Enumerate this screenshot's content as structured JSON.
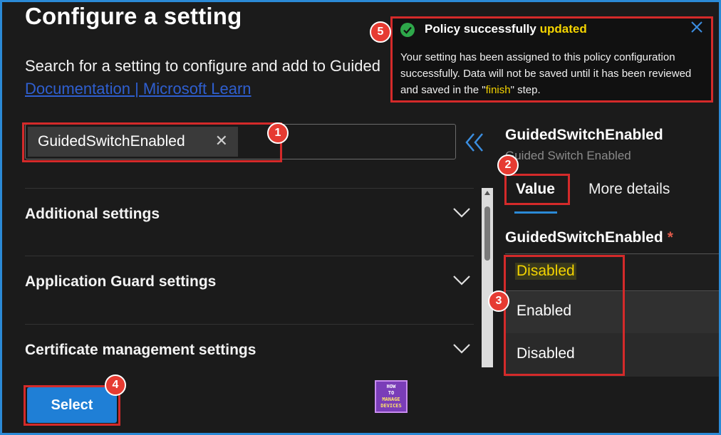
{
  "page": {
    "title": "Configure a setting",
    "description": "Search for a setting to configure and add to Guided",
    "doc_link": "Documentation | Microsoft Learn"
  },
  "search": {
    "chip_value": "GuidedSwitchEnabled",
    "clear_icon": "close-icon"
  },
  "collapse_icon": "double-chevron-left-icon",
  "sections": [
    {
      "label": "Additional settings",
      "icon": "chevron-down-icon"
    },
    {
      "label": "Application Guard settings",
      "icon": "chevron-down-icon"
    },
    {
      "label": "Certificate management settings",
      "icon": "chevron-down-icon"
    }
  ],
  "footer": {
    "select_label": "Select",
    "logo_lines": [
      "HOW",
      "TO",
      "MANAGE",
      "DEVICES"
    ]
  },
  "detail": {
    "title": "GuidedSwitchEnabled",
    "subtitle": "Guided Switch Enabled",
    "tabs": [
      "Value",
      "More details"
    ],
    "field_label": "GuidedSwitchEnabled",
    "required_mark": "*",
    "dropdown": {
      "selected": "Disabled",
      "options": [
        "Enabled",
        "Disabled"
      ]
    }
  },
  "toast": {
    "title_prefix": "Policy successfully ",
    "title_highlight": "updated",
    "body_part1": "Your setting has been assigned to this policy configuration successfully. Data will not be saved until it has been reviewed and saved in the \"",
    "body_highlight": "finish",
    "body_part2": "\" step."
  },
  "annotations": [
    "1",
    "2",
    "3",
    "4",
    "5"
  ],
  "colors": {
    "background": "#1b1b1b",
    "accent": "#1f7fd6",
    "annotation": "#d42a2a",
    "highlight": "#f4d400",
    "success": "#2ea84a"
  }
}
